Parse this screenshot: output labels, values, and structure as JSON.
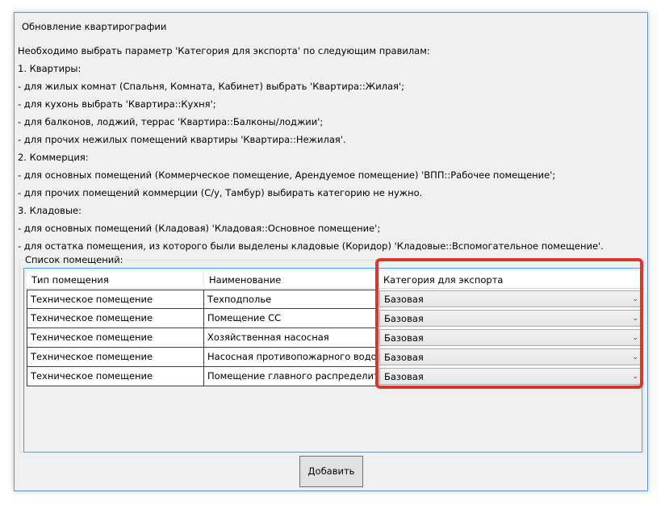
{
  "window": {
    "title": "Обновление квартирографии"
  },
  "instructions": [
    "Необходимо выбрать параметр 'Категория для экспорта' по следующим правилам:",
    "1. Квартиры:",
    "- для жилых комнат (Спальня, Комната, Кабинет) выбрать 'Квартира::Жилая';",
    "- для кухонь выбрать 'Квартира::Кухня';",
    "- для балконов, лоджий, террас 'Квартира::Балконы/лоджии';",
    "- для прочих нежилых помещений квартиры 'Квартира::Нежилая'.",
    "2. Коммерция:",
    "- для основных помещений (Коммерческое помещение, Арендуемое помещение) 'ВПП::Рабочее помещение';",
    "- для прочих помещений коммерции (С/у, Тамбур) выбирать категорию не нужно.",
    "3. Кладовые:",
    "- для основных помещений (Кладовая) 'Кладовая::Основное помещение';",
    "- для остатка помещения, из которого были выделены кладовые (Коридор) 'Кладовые::Вспомогательное помещение'."
  ],
  "rooms_group": {
    "label": "Список помещений:",
    "columns": [
      "Тип помещения",
      "Наименование",
      "Категория для экспорта"
    ],
    "rows": [
      {
        "type": "Техническое помещение",
        "name": "Техподполье",
        "category": "Базовая"
      },
      {
        "type": "Техническое помещение",
        "name": "Помещение СС",
        "category": "Базовая"
      },
      {
        "type": "Техническое помещение",
        "name": "Хозяйственная насосная",
        "category": "Базовая"
      },
      {
        "type": "Техническое помещение",
        "name": "Насосная противопожарного водоснабжения",
        "category": "Базовая"
      },
      {
        "type": "Техническое помещение",
        "name": "Помещение главного распределительного щита",
        "category": "Базовая"
      }
    ]
  },
  "add_button": "Добавить",
  "colors": {
    "highlight": "#d9372b",
    "window_border": "#5b9bd5"
  }
}
